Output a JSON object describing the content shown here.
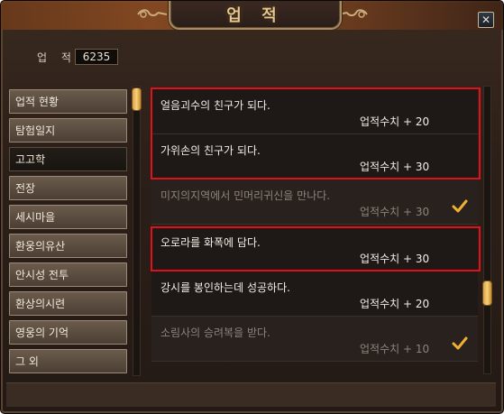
{
  "window": {
    "title": "업 적"
  },
  "score": {
    "label": "업 적",
    "value": "6235"
  },
  "categories": [
    {
      "label": "업적 현황"
    },
    {
      "label": "탐험일지"
    },
    {
      "label": "고고학",
      "active": true
    },
    {
      "label": "전장"
    },
    {
      "label": "세시마을"
    },
    {
      "label": "환웅의유산"
    },
    {
      "label": "안시성 전투"
    },
    {
      "label": "환상의시련"
    },
    {
      "label": "영웅의 기억"
    },
    {
      "label": "그 외"
    }
  ],
  "achievements": [
    {
      "title": "얼음괴수의 친구가 되다.",
      "points": "업적수치 + 20",
      "completed": false,
      "highlighted": true
    },
    {
      "title": "가위손의 친구가 되다.",
      "points": "업적수치 + 30",
      "completed": false,
      "highlighted": true
    },
    {
      "title": "미지의지역에서 민머리귀신을 만나다.",
      "points": "업적수치 + 30",
      "completed": true,
      "highlighted": false
    },
    {
      "title": "오로라를 화폭에 담다.",
      "points": "업적수치 + 30",
      "completed": false,
      "highlighted": true
    },
    {
      "title": "강시를 봉인하는데 성공하다.",
      "points": "업적수치 + 20",
      "completed": false,
      "highlighted": false
    },
    {
      "title": "소림사의 승려복을 받다.",
      "points": "업적수치 + 10",
      "completed": true,
      "highlighted": false
    }
  ],
  "colors": {
    "highlight": "#e0111a",
    "check": "#f0b030",
    "accent_gold": "#e6c890"
  }
}
